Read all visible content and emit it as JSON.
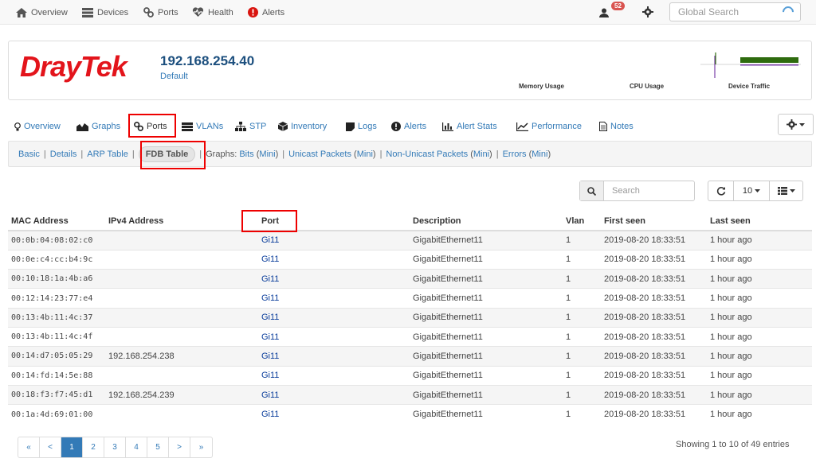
{
  "topnav": {
    "items": [
      {
        "label": "Overview",
        "icon": "home-icon"
      },
      {
        "label": "Devices",
        "icon": "server-icon"
      },
      {
        "label": "Ports",
        "icon": "link-icon"
      },
      {
        "label": "Health",
        "icon": "heartbeat-icon"
      },
      {
        "label": "Alerts",
        "icon": "exclamation-circle-icon"
      }
    ],
    "notification_count": "52",
    "search_placeholder": "Global Search"
  },
  "device": {
    "logo_text": "DrayTek",
    "ip": "192.168.254.40",
    "group": "Default",
    "graph_labels": {
      "memory": "Memory Usage",
      "cpu": "CPU Usage",
      "traffic": "Device Traffic"
    },
    "colors": {
      "logo": "#e3141b",
      "traffic_bar": "#2e6b0e"
    }
  },
  "tabs": [
    {
      "label": "Overview",
      "icon": "lightbulb-icon"
    },
    {
      "label": "Graphs",
      "icon": "area-chart-icon"
    },
    {
      "label": "Ports",
      "icon": "link-icon"
    },
    {
      "label": "VLANs",
      "icon": "tasks-icon"
    },
    {
      "label": "STP",
      "icon": "sitemap-icon"
    },
    {
      "label": "Inventory",
      "icon": "cube-icon"
    },
    {
      "label": "Logs",
      "icon": "sticky-note-icon"
    },
    {
      "label": "Alerts",
      "icon": "exclamation-circle-icon"
    },
    {
      "label": "Alert Stats",
      "icon": "bar-chart-icon"
    },
    {
      "label": "Performance",
      "icon": "line-chart-icon"
    },
    {
      "label": "Notes",
      "icon": "file-text-icon"
    }
  ],
  "subnav": {
    "basic": "Basic",
    "details": "Details",
    "arp": "ARP Table",
    "fdb": "FDB Table",
    "graphs_prefix": "Graphs:",
    "bits": "Bits",
    "unicast": "Unicast Packets",
    "nonunicast": "Non-Unicast Packets",
    "errors": "Errors",
    "mini": "Mini"
  },
  "toolbar": {
    "search_placeholder": "Search",
    "page_size": "10"
  },
  "table": {
    "columns": [
      "MAC Address",
      "IPv4 Address",
      "Port",
      "Description",
      "Vlan",
      "First seen",
      "Last seen"
    ],
    "rows": [
      {
        "mac": "00:0b:04:08:02:c0",
        "ip": "",
        "port": "Gi11",
        "desc": "GigabitEthernet11",
        "vlan": "1",
        "first": "2019-08-20 18:33:51",
        "last": "1 hour ago"
      },
      {
        "mac": "00:0e:c4:cc:b4:9c",
        "ip": "",
        "port": "Gi11",
        "desc": "GigabitEthernet11",
        "vlan": "1",
        "first": "2019-08-20 18:33:51",
        "last": "1 hour ago"
      },
      {
        "mac": "00:10:18:1a:4b:a6",
        "ip": "",
        "port": "Gi11",
        "desc": "GigabitEthernet11",
        "vlan": "1",
        "first": "2019-08-20 18:33:51",
        "last": "1 hour ago"
      },
      {
        "mac": "00:12:14:23:77:e4",
        "ip": "",
        "port": "Gi11",
        "desc": "GigabitEthernet11",
        "vlan": "1",
        "first": "2019-08-20 18:33:51",
        "last": "1 hour ago"
      },
      {
        "mac": "00:13:4b:11:4c:37",
        "ip": "",
        "port": "Gi11",
        "desc": "GigabitEthernet11",
        "vlan": "1",
        "first": "2019-08-20 18:33:51",
        "last": "1 hour ago"
      },
      {
        "mac": "00:13:4b:11:4c:4f",
        "ip": "",
        "port": "Gi11",
        "desc": "GigabitEthernet11",
        "vlan": "1",
        "first": "2019-08-20 18:33:51",
        "last": "1 hour ago"
      },
      {
        "mac": "00:14:d7:05:05:29",
        "ip": "192.168.254.238",
        "port": "Gi11",
        "desc": "GigabitEthernet11",
        "vlan": "1",
        "first": "2019-08-20 18:33:51",
        "last": "1 hour ago"
      },
      {
        "mac": "00:14:fd:14:5e:88",
        "ip": "",
        "port": "Gi11",
        "desc": "GigabitEthernet11",
        "vlan": "1",
        "first": "2019-08-20 18:33:51",
        "last": "1 hour ago"
      },
      {
        "mac": "00:18:f3:f7:45:d1",
        "ip": "192.168.254.239",
        "port": "Gi11",
        "desc": "GigabitEthernet11",
        "vlan": "1",
        "first": "2019-08-20 18:33:51",
        "last": "1 hour ago"
      },
      {
        "mac": "00:1a:4d:69:01:00",
        "ip": "",
        "port": "Gi11",
        "desc": "GigabitEthernet11",
        "vlan": "1",
        "first": "2019-08-20 18:33:51",
        "last": "1 hour ago"
      }
    ]
  },
  "pagination": {
    "first": "«",
    "prev": "<",
    "pages": [
      "1",
      "2",
      "3",
      "4",
      "5"
    ],
    "next": ">",
    "last": "»",
    "current": "1"
  },
  "footer": {
    "showing": "Showing 1 to 10 of 49 entries"
  }
}
